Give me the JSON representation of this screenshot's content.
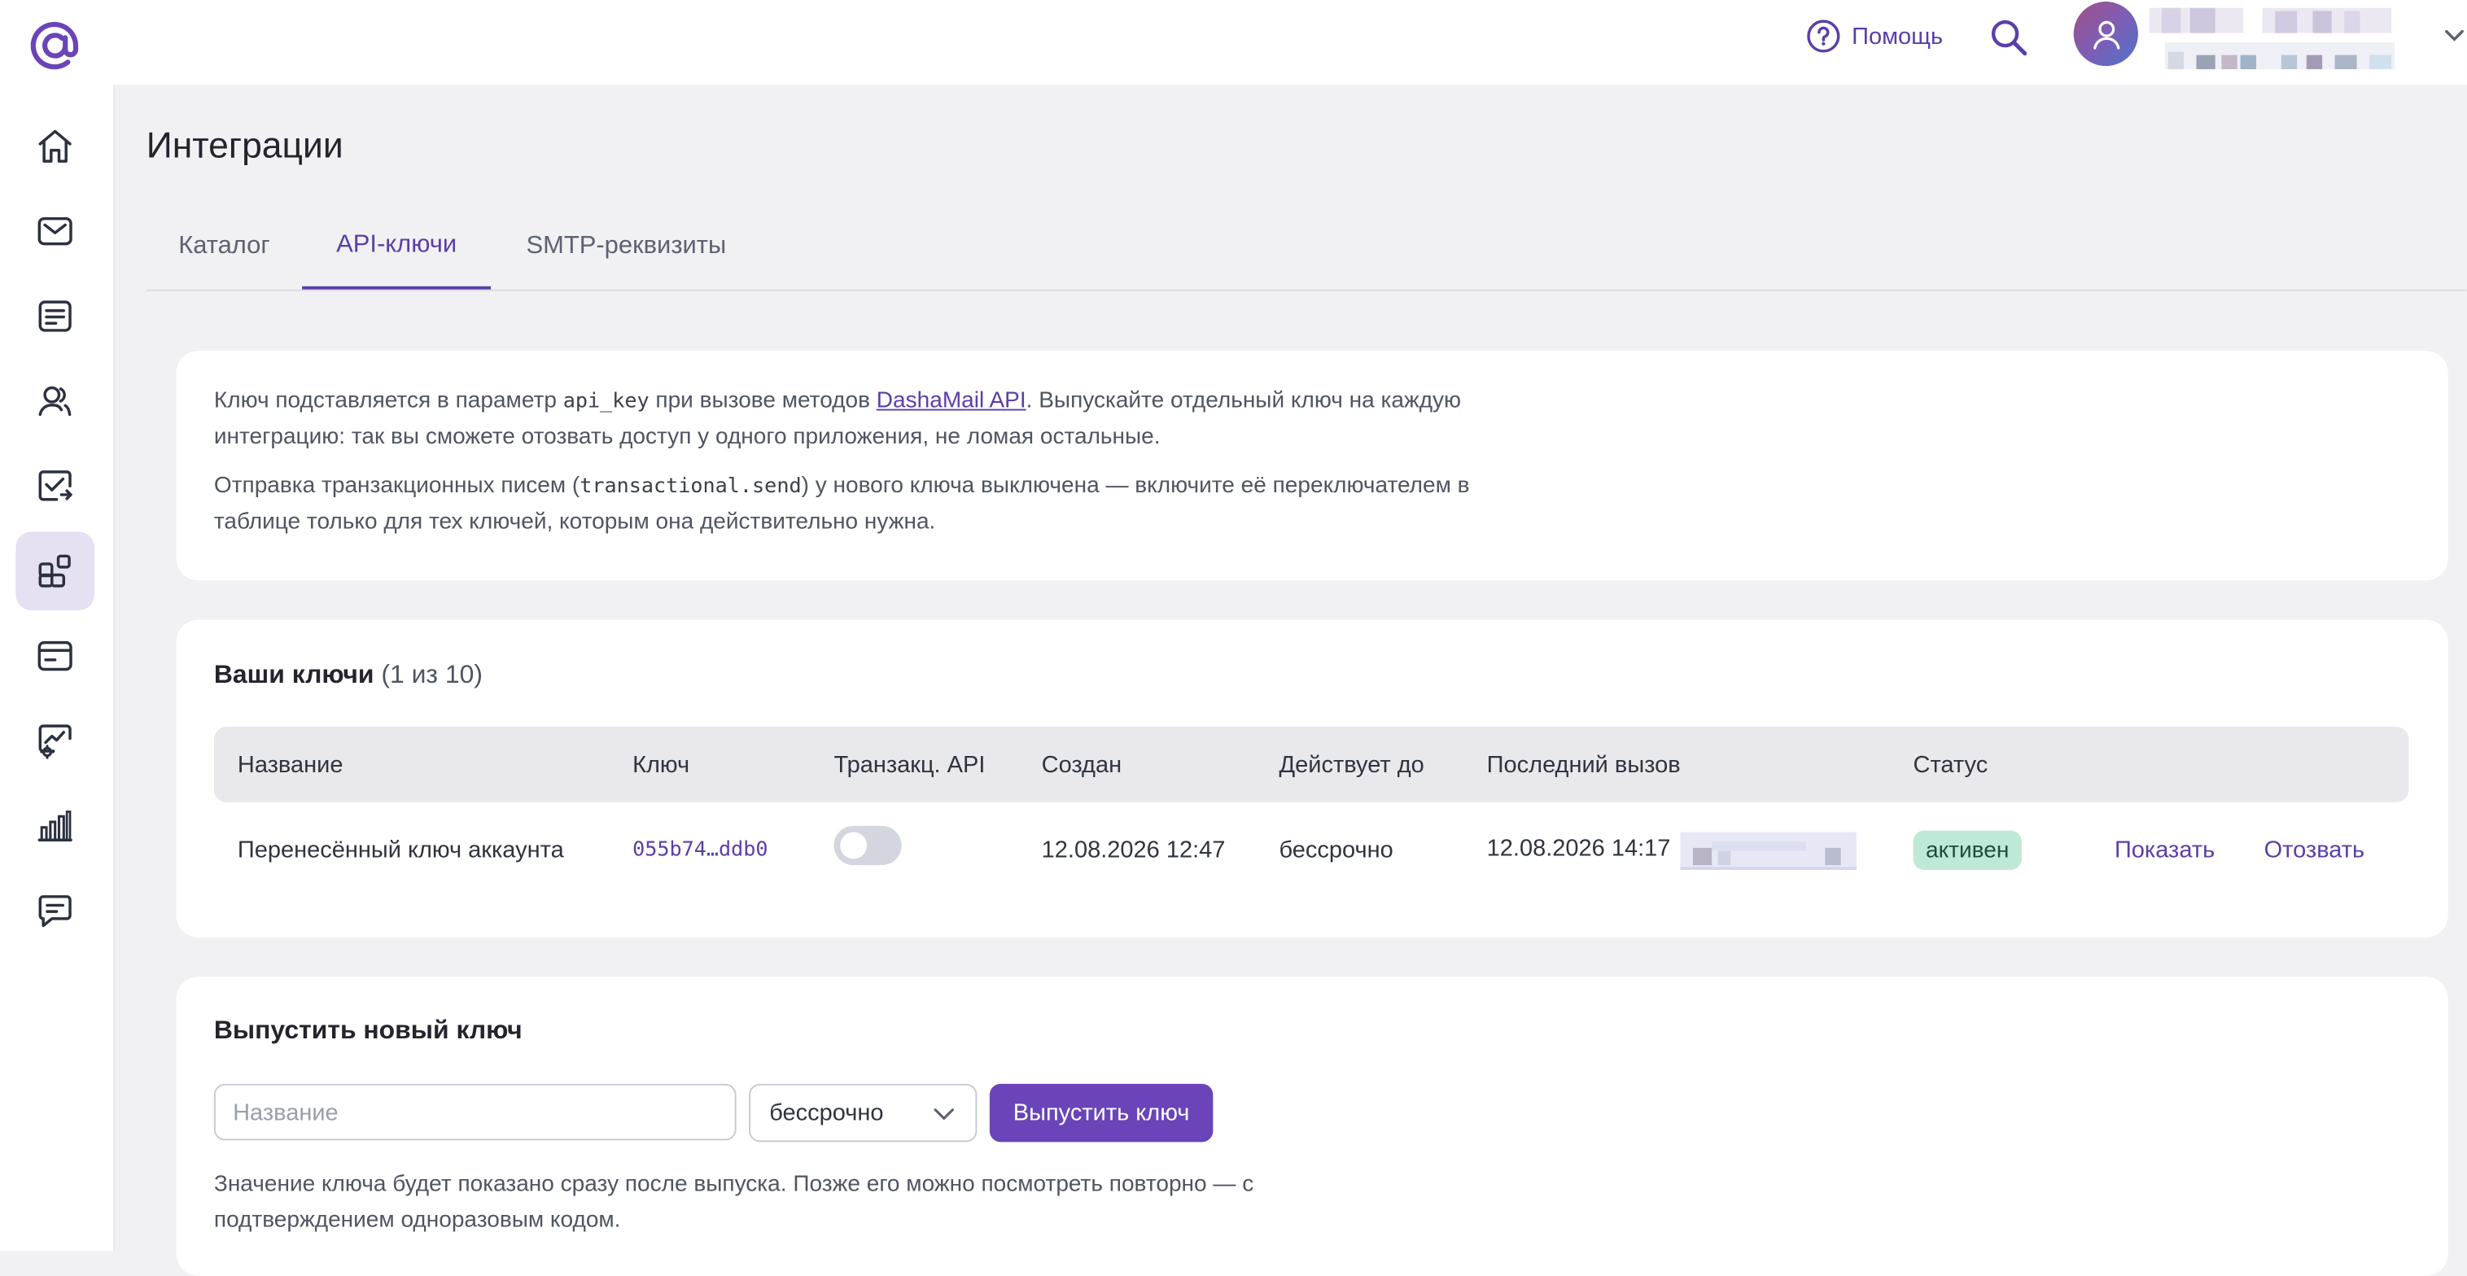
{
  "header": {
    "help_label": "Помощь"
  },
  "page": {
    "title": "Интеграции"
  },
  "tabs": [
    {
      "label": "Каталог",
      "active": false
    },
    {
      "label": "API-ключи",
      "active": true
    },
    {
      "label": "SMTP-реквизиты",
      "active": false
    }
  ],
  "sidebar": {
    "icons": [
      "home-icon",
      "mail-icon",
      "list-icon",
      "contacts-icon",
      "task-check-icon",
      "integrations-icon",
      "browser-window-icon",
      "dashboard-settings-icon",
      "stats-bars-icon",
      "chat-icon"
    ],
    "active_index": 5
  },
  "info": {
    "p1_a": "Ключ подставляется в параметр ",
    "p1_code": "api_key",
    "p1_b": " при вызове методов ",
    "p1_link": "DashaMail API",
    "p1_c": ". Выпускайте отдельный ключ на каждую интеграцию: так вы сможете отозвать доступ у одного приложения, не ломая остальные.",
    "p2_a": "Отправка транзакционных писем (",
    "p2_code": "transactional.send",
    "p2_b": ") у нового ключа выключена — включите её переключателем в таблице только для тех ключей, которым она действительно нужна."
  },
  "keys": {
    "title": "Ваши ключи",
    "count": "(1 из 10)",
    "columns": {
      "name": "Название",
      "key": "Ключ",
      "transact": "Транзакц. API",
      "created": "Создан",
      "valid_until": "Действует до",
      "last_call": "Последний вызов",
      "status": "Статус"
    },
    "rows": [
      {
        "name": "Перенесённый ключ аккаунта",
        "key": "055b74…ddb0",
        "transact_enabled": false,
        "created": "12.08.2026 12:47",
        "valid_until": "бессрочно",
        "last_call": "12.08.2026 14:17",
        "status": "активен",
        "show_label": "Показать",
        "revoke_label": "Отозвать"
      }
    ]
  },
  "new_key": {
    "title": "Выпустить новый ключ",
    "name_placeholder": "Название",
    "term_value": "бессрочно",
    "submit_label": "Выпустить ключ",
    "hint": "Значение ключа будет показано сразу после выпуска. Позже его можно посмотреть повторно — с подтверждением одноразовым кодом."
  },
  "colors": {
    "accent": "#5b3fa8",
    "button": "#6a44b8",
    "status_active_bg": "#bfe9d7",
    "page_bg": "#f1f1f4"
  }
}
